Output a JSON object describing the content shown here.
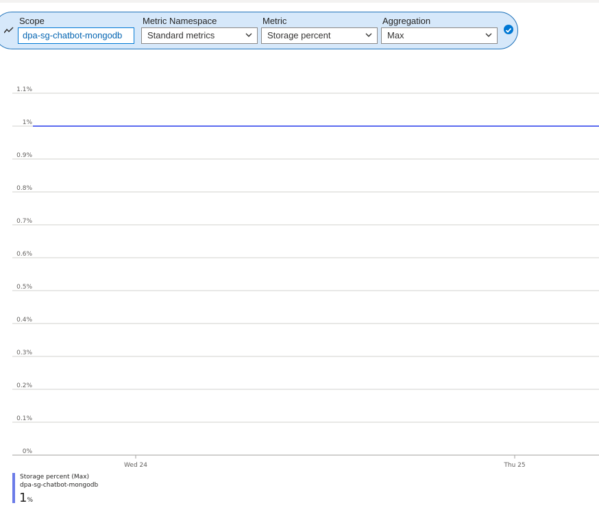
{
  "selector": {
    "scope_label": "Scope",
    "scope_value": "dpa-sg-chatbot-mongodb",
    "namespace_label": "Metric Namespace",
    "namespace_value": "Standard metrics",
    "metric_label": "Metric",
    "metric_value": "Storage percent",
    "aggregation_label": "Aggregation",
    "aggregation_value": "Max",
    "icons": [
      "metric-trend-icon",
      "chevron-down-icon",
      "checkmark-circle-icon"
    ],
    "accent_color": "#0078d4"
  },
  "chart_data": {
    "type": "line",
    "y_ticks": [
      "0%",
      "0.1%",
      "0.2%",
      "0.3%",
      "0.4%",
      "0.5%",
      "0.6%",
      "0.7%",
      "0.8%",
      "0.9%",
      "1%",
      "1.1%"
    ],
    "ylim": [
      0,
      1.1
    ],
    "x_ticks": [
      "Wed 24",
      "Thu 25"
    ],
    "grid": true,
    "series": [
      {
        "values": [
          1,
          1
        ],
        "color": "#5b6bf0"
      }
    ]
  },
  "legend": {
    "name": "Storage percent (Max)",
    "scope": "dpa-sg-chatbot-mongodb",
    "value": "1",
    "unit": "%"
  }
}
